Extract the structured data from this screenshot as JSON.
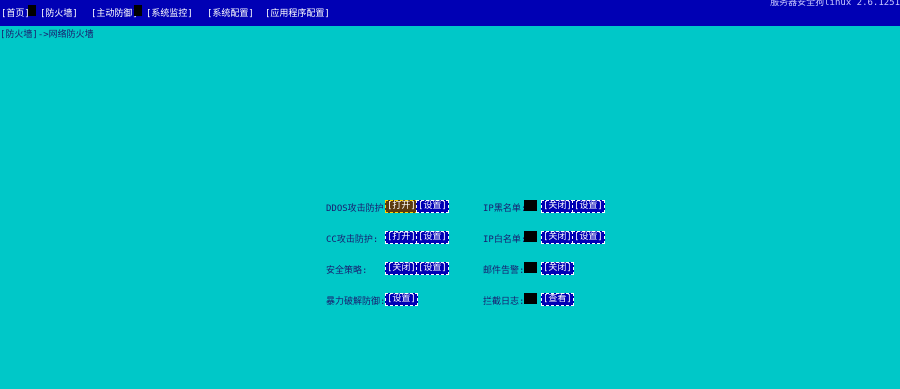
{
  "topbar": {
    "menu": [
      {
        "label": "[首页]"
      },
      {
        "label": "[防火墙]"
      },
      {
        "label": "[主动防御]"
      },
      {
        "label": "[系统监控]"
      },
      {
        "label": "[系统配置]"
      },
      {
        "label": "[应用程序配置]"
      }
    ],
    "version": "服务器安全狗linux 2.6.1251"
  },
  "breadcrumb": "[防火墙]->网络防火墙",
  "settings": {
    "ddos": {
      "label": "DDOS攻击防护:",
      "toggle": "[打开]",
      "config": "[设置]"
    },
    "cc": {
      "label": "CC攻击防护:",
      "toggle": "[打开]",
      "config": "[设置]"
    },
    "policy": {
      "label": "安全策略:",
      "toggle": "[关闭]",
      "config": "[设置]"
    },
    "bruteforce": {
      "label": "暴力破解防御:",
      "config": "[设置]"
    },
    "ip_blacklist": {
      "label": "IP黑名单:",
      "toggle": "[关闭]",
      "config": "[设置]"
    },
    "ip_whitelist": {
      "label": "IP白名单:",
      "toggle": "[关闭]",
      "config": "[设置]"
    },
    "mail_alert": {
      "label": "邮件告警:",
      "toggle": "[关闭]"
    },
    "intercept_log": {
      "label": "拦截日志:",
      "view": "[查看]"
    }
  }
}
